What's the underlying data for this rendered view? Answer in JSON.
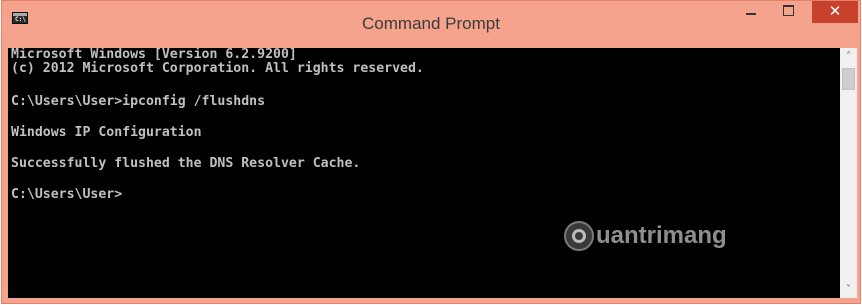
{
  "window": {
    "title": "Command Prompt",
    "icon": "cmd-app-icon",
    "controls": {
      "minimize_icon": "minimize-icon",
      "maximize_icon": "maximize-icon",
      "close_label": "✕"
    },
    "colors": {
      "frame": "#f5a38d",
      "close_button": "#c7412c",
      "console_bg": "#000000",
      "console_text": "#c0c0c0"
    }
  },
  "console": {
    "lines": [
      "Microsoft Windows [Version 6.2.9200]",
      "(c) 2012 Microsoft Corporation. All rights reserved.",
      "C:\\Users\\User>ipconfig /flushdns",
      "Windows IP Configuration",
      "Successfully flushed the DNS Resolver Cache.",
      "C:\\Users\\User>"
    ]
  },
  "watermark": {
    "text": "uantrimang"
  },
  "scrollbar": {
    "up_arrow": "˄",
    "down_arrow": "˅"
  }
}
